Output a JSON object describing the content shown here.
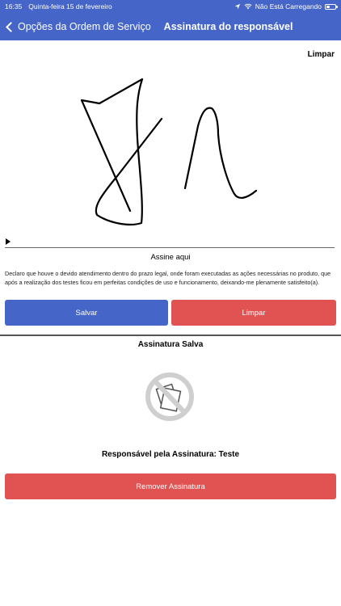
{
  "status_bar": {
    "time": "16:35",
    "date": "Quinta-feira 15 de fevereiro",
    "charging_status": "Não Está Carregando"
  },
  "nav": {
    "back_label": "Opções da Ordem de Serviço",
    "title": "Assinatura do responsável"
  },
  "signature_pad": {
    "clear_label": "Limpar",
    "sign_here_label": "Assine aqui",
    "declaration": "Declaro que houve o devido atendimento dentro do prazo legal, onde foram executadas as ações necessárias no produto, que após a realização dos testes ficou em perfeitas condições de uso e funcionamento, deixando-me plenamente satisfeito(a)."
  },
  "actions": {
    "save_label": "Salvar",
    "clear_label": "Limpar"
  },
  "saved_signature": {
    "title": "Assinatura Salva",
    "image_placeholder_icon": "no-image-icon",
    "responsible_label": "Responsável pela Assinatura: Teste",
    "remove_label": "Remover Assinatura"
  },
  "colors": {
    "primary": "#4565c9",
    "danger": "#e05352"
  }
}
